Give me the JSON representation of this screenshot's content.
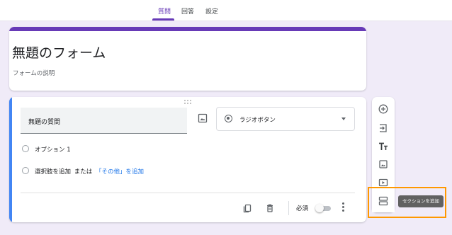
{
  "tabs": [
    {
      "label": "質問",
      "active": true
    },
    {
      "label": "回答",
      "active": false
    },
    {
      "label": "設定",
      "active": false
    }
  ],
  "form": {
    "title": "無題のフォーム",
    "description": "フォームの説明"
  },
  "question": {
    "title": "無題の質問",
    "type_label": "ラジオボタン",
    "options": [
      "オプション 1"
    ],
    "add_option_text": "選択肢を追加",
    "or_text": "または",
    "add_other_text": "「その他」を追加",
    "required_label": "必須",
    "required": false
  },
  "side_toolbar": {
    "tooltip": "セクションを追加"
  },
  "colors": {
    "accent": "#673ab7",
    "background": "#f0ebf8",
    "focus_bar": "#4285f4",
    "link": "#1a73e8",
    "highlight": "#ff9800"
  }
}
